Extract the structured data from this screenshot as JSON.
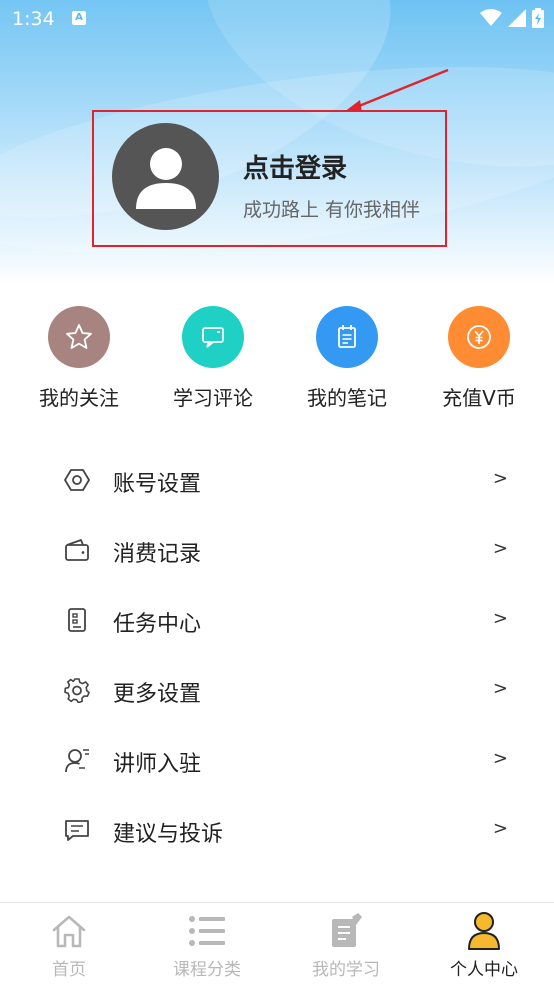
{
  "status_bar": {
    "time": "1:34",
    "notif_badge": "A"
  },
  "profile": {
    "title": "点击登录",
    "subtitle": "成功路上 有你我相伴"
  },
  "quick_actions": [
    {
      "label": "我的关注",
      "color": "#a88481",
      "icon": "star-icon"
    },
    {
      "label": "学习评论",
      "color": "#1fd1c4",
      "icon": "chat-icon"
    },
    {
      "label": "我的笔记",
      "color": "#3399f3",
      "icon": "notepad-icon"
    },
    {
      "label": "充值V币",
      "color": "#ff8c33",
      "icon": "yen-coin-icon"
    }
  ],
  "menu": [
    {
      "label": "账号设置",
      "icon": "hexagon-settings-icon",
      "chevron": ">"
    },
    {
      "label": "消费记录",
      "icon": "wallet-icon",
      "chevron": ">"
    },
    {
      "label": "任务中心",
      "icon": "task-clipboard-icon",
      "chevron": ">"
    },
    {
      "label": "更多设置",
      "icon": "gear-icon",
      "chevron": ">"
    },
    {
      "label": "讲师入驻",
      "icon": "lecturer-icon",
      "chevron": ">"
    },
    {
      "label": "建议与投诉",
      "icon": "feedback-icon",
      "chevron": ">"
    }
  ],
  "bottom_nav": [
    {
      "label": "首页",
      "icon": "home-icon",
      "active": false
    },
    {
      "label": "课程分类",
      "icon": "list-icon",
      "active": false
    },
    {
      "label": "我的学习",
      "icon": "study-book-icon",
      "active": false
    },
    {
      "label": "个人中心",
      "icon": "person-icon",
      "active": true,
      "color": "#f5b82e"
    }
  ],
  "colors": {
    "annotation": "#e0242e",
    "avatar_bg": "#555555",
    "header_blue": "#56b9f1"
  }
}
